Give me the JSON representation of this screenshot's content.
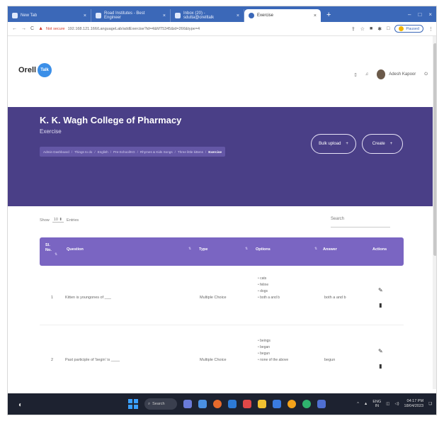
{
  "browser": {
    "tabs": [
      {
        "label": "New Tab",
        "active": false
      },
      {
        "label": "Road Institutes - Best Engineer",
        "active": false
      },
      {
        "label": "Inbox (20) - sdutta@orelltalk",
        "active": false
      },
      {
        "label": "Exercise",
        "active": true
      }
    ],
    "new_tab": "+",
    "window_controls": [
      "–",
      "□",
      "×"
    ],
    "nav": {
      "back": "←",
      "forward": "→",
      "reload": "C"
    },
    "not_secure": "Not secure",
    "url": "192.168.121.166/LanguageLab/addExercise?id=4&MT5345&id=266&type=4",
    "paused_label": "Paused"
  },
  "app": {
    "logo_text": "Orell",
    "logo_badge": "Talk",
    "user_name": "Adesh Kapoor"
  },
  "banner": {
    "college": "K. K. Wagh College of Pharmacy",
    "subtitle": "Exercise",
    "breadcrumbs": [
      "Admin Dashboard",
      "Things to do",
      "English",
      "Pre-School/KG",
      "Rhymes & Kids Songs",
      "Three little kittens",
      "Exercise"
    ],
    "bulk_upload": "Bulk upload",
    "create": "Create",
    "plus": "+"
  },
  "table": {
    "show_label": "Show",
    "show_value": "10",
    "entries_label": "Entries",
    "search_placeholder": "Search",
    "headers": {
      "sl": "Sl.",
      "no": "No.",
      "question": "Question",
      "type": "Type",
      "options": "Options",
      "answer": "Answer",
      "actions": "Actions"
    },
    "rows": [
      {
        "no": "1",
        "question": "Kitten is youngones of ___",
        "type": "Multiple Choice",
        "options": [
          "cats",
          "feline",
          "dogs",
          "both a and b"
        ],
        "answer": "both a and b"
      },
      {
        "no": "2",
        "question": "Past participle of 'begin' is ____",
        "type": "Multiple Choice",
        "options": [
          "beings",
          "began",
          "begun",
          "none of the above"
        ],
        "answer": "begun"
      }
    ]
  },
  "taskbar": {
    "search_label": "Search",
    "lang": "ENG",
    "region": "IN",
    "time": "04:17 PM",
    "date": "18/04/2023"
  },
  "colors": {
    "banner": "#4a3f87",
    "table_header": "#7a65c2",
    "tab_bar": "#3b68b8",
    "taskbar": "#1d2230"
  }
}
